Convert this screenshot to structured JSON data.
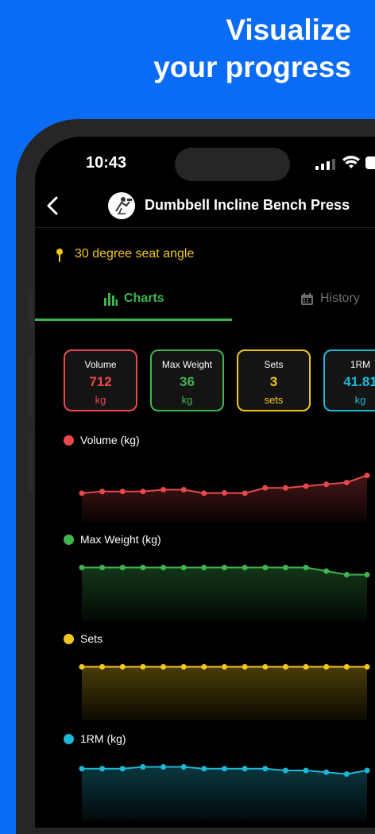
{
  "headline": {
    "line1": "Visualize",
    "line2": "your progress"
  },
  "status_bar": {
    "time": "10:43"
  },
  "header": {
    "title": "Dumbbell Incline Bench Press"
  },
  "note": {
    "text": "30 degree seat angle"
  },
  "tabs": [
    {
      "label": "Charts",
      "active": true
    },
    {
      "label": "History",
      "active": false
    }
  ],
  "stat_cards": [
    {
      "title": "Volume",
      "value": "712",
      "unit": "kg",
      "color": "#e8484a"
    },
    {
      "title": "Max Weight",
      "value": "36",
      "unit": "kg",
      "color": "#3fb44f"
    },
    {
      "title": "Sets",
      "value": "3",
      "unit": "sets",
      "color": "#f2c71b"
    },
    {
      "title": "1RM",
      "value": "41.81",
      "unit": "kg",
      "color": "#1eb8d6"
    }
  ],
  "colors": {
    "brand_background": "#0a6cf5",
    "accent_green": "#3fb44f",
    "note_yellow": "#f2c71b",
    "volume": "#e8484a",
    "max_weight": "#3fb44f",
    "sets": "#f2c71b",
    "one_rm": "#1eb8d6"
  },
  "chart_data": [
    {
      "type": "area",
      "title": "Volume (kg)",
      "color": "#e8484a",
      "ylim": [
        560,
        760
      ],
      "values": [
        640,
        645,
        645,
        645,
        650,
        650,
        640,
        641,
        640,
        655,
        655,
        660,
        665,
        670,
        690
      ]
    },
    {
      "type": "area",
      "title": "Max Weight (kg)",
      "color": "#3fb44f",
      "ylim": [
        30,
        38
      ],
      "values": [
        36,
        36,
        36,
        36,
        36,
        36,
        36,
        36,
        36,
        36,
        36,
        36,
        35.6,
        35.2,
        35.2
      ]
    },
    {
      "type": "area",
      "title": "Sets",
      "color": "#f2c71b",
      "ylim": [
        0,
        4
      ],
      "values": [
        3,
        3,
        3,
        3,
        3,
        3,
        3,
        3,
        3,
        3,
        3,
        3,
        3,
        3,
        3
      ]
    },
    {
      "type": "area",
      "title": "1RM (kg)",
      "color": "#1eb8d6",
      "ylim": [
        36,
        44
      ],
      "values": [
        41.8,
        41.8,
        41.8,
        42.0,
        42.0,
        42.0,
        41.8,
        41.8,
        41.8,
        41.8,
        41.6,
        41.6,
        41.4,
        41.2,
        41.6
      ]
    }
  ]
}
